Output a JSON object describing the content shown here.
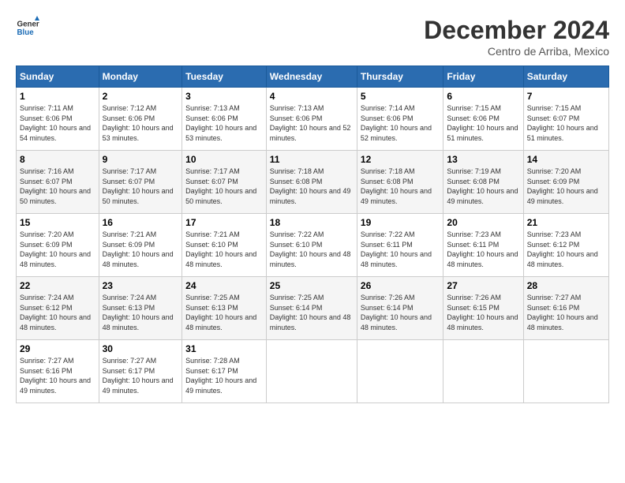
{
  "header": {
    "logo_line1": "General",
    "logo_line2": "Blue",
    "month": "December 2024",
    "location": "Centro de Arriba, Mexico"
  },
  "weekdays": [
    "Sunday",
    "Monday",
    "Tuesday",
    "Wednesday",
    "Thursday",
    "Friday",
    "Saturday"
  ],
  "weeks": [
    [
      {
        "day": "1",
        "sunrise": "7:11 AM",
        "sunset": "6:06 PM",
        "daylight": "10 hours and 54 minutes."
      },
      {
        "day": "2",
        "sunrise": "7:12 AM",
        "sunset": "6:06 PM",
        "daylight": "10 hours and 53 minutes."
      },
      {
        "day": "3",
        "sunrise": "7:13 AM",
        "sunset": "6:06 PM",
        "daylight": "10 hours and 53 minutes."
      },
      {
        "day": "4",
        "sunrise": "7:13 AM",
        "sunset": "6:06 PM",
        "daylight": "10 hours and 52 minutes."
      },
      {
        "day": "5",
        "sunrise": "7:14 AM",
        "sunset": "6:06 PM",
        "daylight": "10 hours and 52 minutes."
      },
      {
        "day": "6",
        "sunrise": "7:15 AM",
        "sunset": "6:06 PM",
        "daylight": "10 hours and 51 minutes."
      },
      {
        "day": "7",
        "sunrise": "7:15 AM",
        "sunset": "6:07 PM",
        "daylight": "10 hours and 51 minutes."
      }
    ],
    [
      {
        "day": "8",
        "sunrise": "7:16 AM",
        "sunset": "6:07 PM",
        "daylight": "10 hours and 50 minutes."
      },
      {
        "day": "9",
        "sunrise": "7:17 AM",
        "sunset": "6:07 PM",
        "daylight": "10 hours and 50 minutes."
      },
      {
        "day": "10",
        "sunrise": "7:17 AM",
        "sunset": "6:07 PM",
        "daylight": "10 hours and 50 minutes."
      },
      {
        "day": "11",
        "sunrise": "7:18 AM",
        "sunset": "6:08 PM",
        "daylight": "10 hours and 49 minutes."
      },
      {
        "day": "12",
        "sunrise": "7:18 AM",
        "sunset": "6:08 PM",
        "daylight": "10 hours and 49 minutes."
      },
      {
        "day": "13",
        "sunrise": "7:19 AM",
        "sunset": "6:08 PM",
        "daylight": "10 hours and 49 minutes."
      },
      {
        "day": "14",
        "sunrise": "7:20 AM",
        "sunset": "6:09 PM",
        "daylight": "10 hours and 49 minutes."
      }
    ],
    [
      {
        "day": "15",
        "sunrise": "7:20 AM",
        "sunset": "6:09 PM",
        "daylight": "10 hours and 48 minutes."
      },
      {
        "day": "16",
        "sunrise": "7:21 AM",
        "sunset": "6:09 PM",
        "daylight": "10 hours and 48 minutes."
      },
      {
        "day": "17",
        "sunrise": "7:21 AM",
        "sunset": "6:10 PM",
        "daylight": "10 hours and 48 minutes."
      },
      {
        "day": "18",
        "sunrise": "7:22 AM",
        "sunset": "6:10 PM",
        "daylight": "10 hours and 48 minutes."
      },
      {
        "day": "19",
        "sunrise": "7:22 AM",
        "sunset": "6:11 PM",
        "daylight": "10 hours and 48 minutes."
      },
      {
        "day": "20",
        "sunrise": "7:23 AM",
        "sunset": "6:11 PM",
        "daylight": "10 hours and 48 minutes."
      },
      {
        "day": "21",
        "sunrise": "7:23 AM",
        "sunset": "6:12 PM",
        "daylight": "10 hours and 48 minutes."
      }
    ],
    [
      {
        "day": "22",
        "sunrise": "7:24 AM",
        "sunset": "6:12 PM",
        "daylight": "10 hours and 48 minutes."
      },
      {
        "day": "23",
        "sunrise": "7:24 AM",
        "sunset": "6:13 PM",
        "daylight": "10 hours and 48 minutes."
      },
      {
        "day": "24",
        "sunrise": "7:25 AM",
        "sunset": "6:13 PM",
        "daylight": "10 hours and 48 minutes."
      },
      {
        "day": "25",
        "sunrise": "7:25 AM",
        "sunset": "6:14 PM",
        "daylight": "10 hours and 48 minutes."
      },
      {
        "day": "26",
        "sunrise": "7:26 AM",
        "sunset": "6:14 PM",
        "daylight": "10 hours and 48 minutes."
      },
      {
        "day": "27",
        "sunrise": "7:26 AM",
        "sunset": "6:15 PM",
        "daylight": "10 hours and 48 minutes."
      },
      {
        "day": "28",
        "sunrise": "7:27 AM",
        "sunset": "6:16 PM",
        "daylight": "10 hours and 48 minutes."
      }
    ],
    [
      {
        "day": "29",
        "sunrise": "7:27 AM",
        "sunset": "6:16 PM",
        "daylight": "10 hours and 49 minutes."
      },
      {
        "day": "30",
        "sunrise": "7:27 AM",
        "sunset": "6:17 PM",
        "daylight": "10 hours and 49 minutes."
      },
      {
        "day": "31",
        "sunrise": "7:28 AM",
        "sunset": "6:17 PM",
        "daylight": "10 hours and 49 minutes."
      },
      null,
      null,
      null,
      null
    ]
  ]
}
